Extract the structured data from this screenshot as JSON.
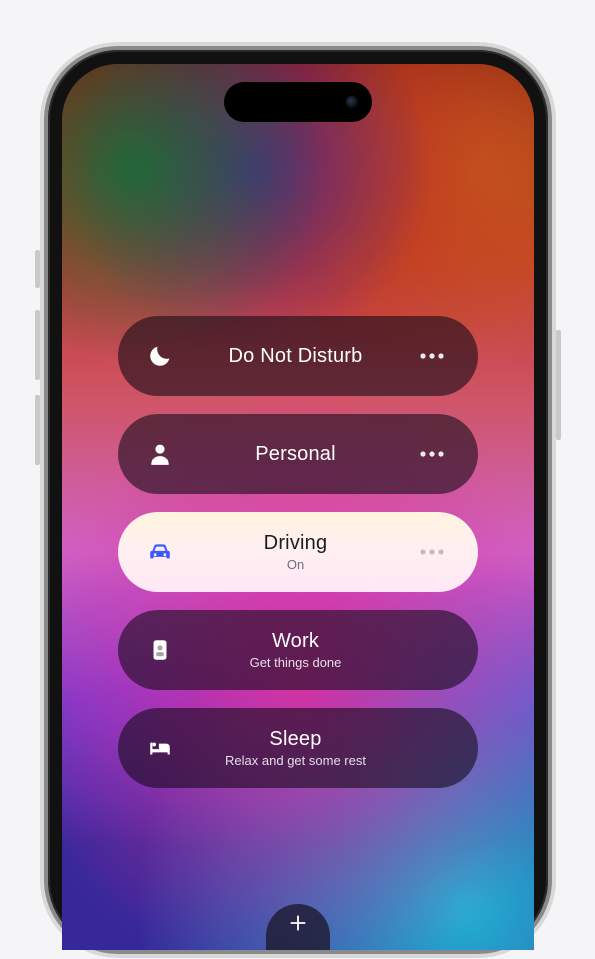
{
  "focus_modes": [
    {
      "icon": "moon",
      "title": "Do Not Disturb",
      "subtitle": "",
      "active": false,
      "show_more": true
    },
    {
      "icon": "person",
      "title": "Personal",
      "subtitle": "",
      "active": false,
      "show_more": true
    },
    {
      "icon": "car",
      "title": "Driving",
      "subtitle": "On",
      "active": true,
      "show_more": true
    },
    {
      "icon": "badge",
      "title": "Work",
      "subtitle": "Get things done",
      "active": false,
      "show_more": false
    },
    {
      "icon": "bed",
      "title": "Sleep",
      "subtitle": "Relax and get some rest",
      "active": false,
      "show_more": false
    }
  ],
  "add_button": {
    "label": "Add Focus"
  }
}
